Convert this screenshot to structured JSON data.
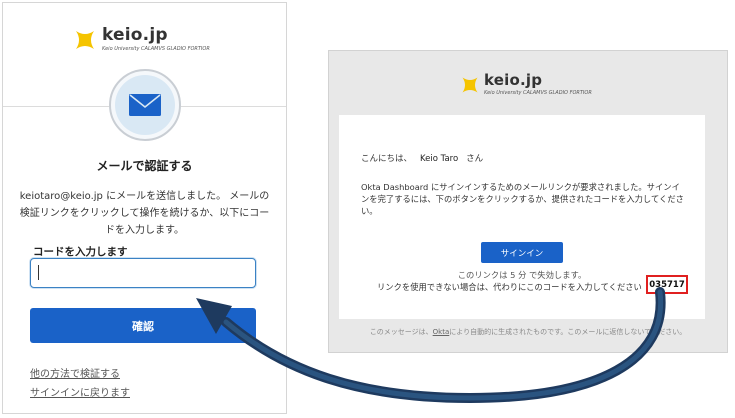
{
  "okta": {
    "brand": {
      "name": "keio.jp",
      "tagline": "Keio University CALAMVS GLADIO FORTIOR"
    },
    "mail_icon": "envelope-icon",
    "title": "メールで認証する",
    "description": "keiotaro@keio.jp にメールを送信しました。 メールの検証リンクをクリックして操作を続けるか、以下にコードを入力します。",
    "code_label": "コードを入力します",
    "code_input": {
      "value": "",
      "placeholder": ""
    },
    "confirm_label": "確認",
    "other_method_link": "他の方法で検証する",
    "back_to_signin_link": "サインインに戻ります"
  },
  "email": {
    "brand": {
      "name": "keio.jp",
      "tagline": "Keio University CALAMVS GLADIO FORTIOR"
    },
    "greeting_prefix": "こんにちは、",
    "user_name": "Keio Taro",
    "greeting_suffix": "さん",
    "body": "Okta Dashboard にサインインするためのメールリンクが要求されました。サインインを完了するには、下のボタンをクリックするか、提供されたコードを入力してください。",
    "signin_label": "サインイン",
    "expire_note": "このリンクは 5 分 で失効します。",
    "fallback_note": "リンクを使用できない場合は、代わりにこのコードを入力してください",
    "code": "035717",
    "footer_prefix": "このメッセージは、",
    "footer_link": "Okta",
    "footer_suffix": "により自動的に生成されたものです。このメールに返信しないでください。"
  },
  "colors": {
    "primary_button": "#1a62c8",
    "highlight_border": "#e02020",
    "arrow_fill": "#1e3a5f",
    "logo_yellow": "#f5c400"
  },
  "icons": [
    "keio-logo-icon",
    "envelope-icon",
    "curved-arrow-icon"
  ]
}
